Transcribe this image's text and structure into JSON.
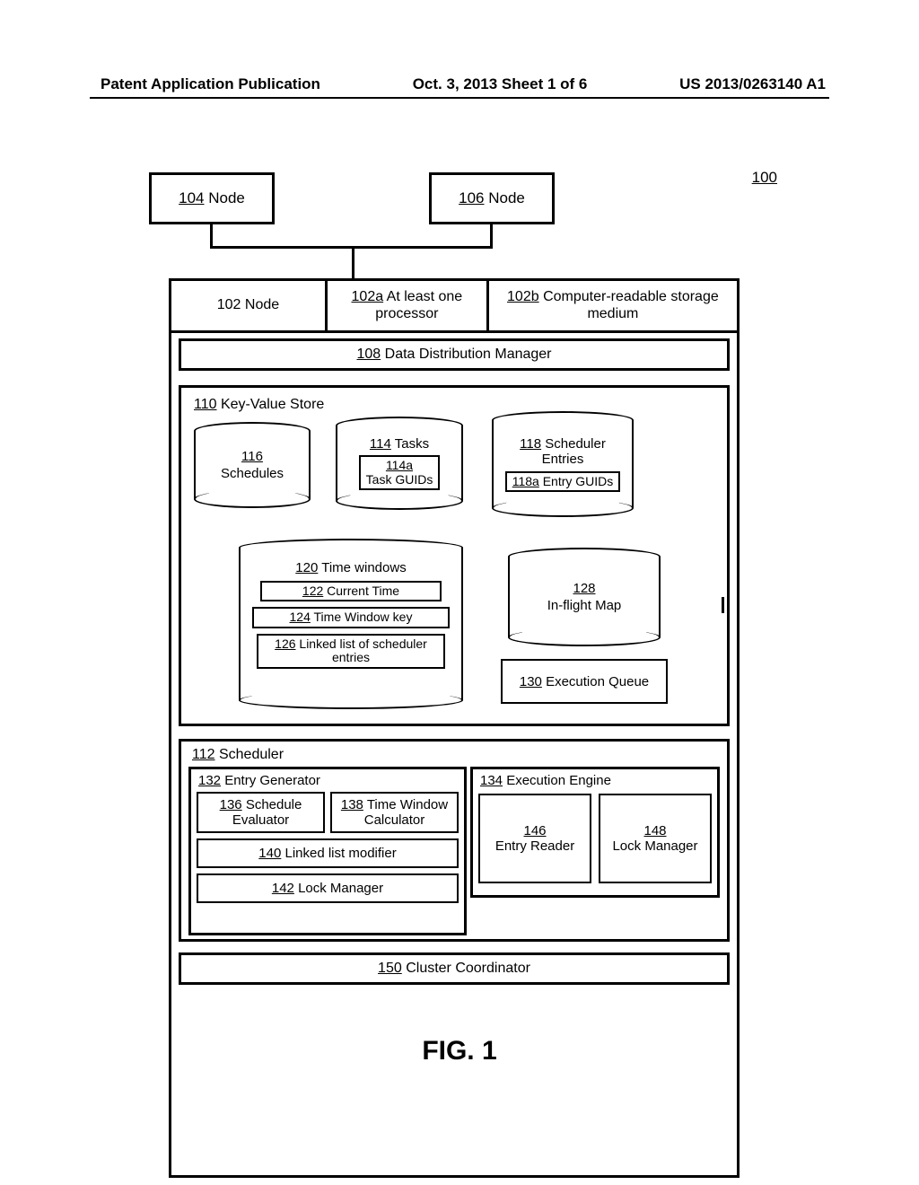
{
  "header": {
    "left": "Patent Application Publication",
    "center": "Oct. 3, 2013   Sheet 1 of 6",
    "right": "US 2013/0263140 A1"
  },
  "system_ref": "100",
  "figure_label": "FIG. 1",
  "nodes": {
    "n104": {
      "ref": "104",
      "label": "Node"
    },
    "n106": {
      "ref": "106",
      "label": "Node"
    },
    "n102": {
      "label": "102 Node"
    },
    "n102a": {
      "ref": "102a",
      "label": "At least one processor"
    },
    "n102b": {
      "ref": "102b",
      "label": "Computer-readable storage medium"
    }
  },
  "ddm": {
    "ref": "108",
    "label": "Data Distribution Manager"
  },
  "kv": {
    "title": {
      "ref": "110",
      "label": "Key-Value Store"
    },
    "c116": {
      "ref": "116",
      "label": "Schedules"
    },
    "c114": {
      "ref": "114",
      "label": "Tasks",
      "inner_ref": "114a",
      "inner_label": "Task GUIDs"
    },
    "c118": {
      "ref": "118",
      "label": "Scheduler Entries",
      "inner_ref": "118a",
      "inner_label": "Entry GUIDs"
    },
    "c120": {
      "ref": "120",
      "label": "Time windows",
      "r122": {
        "ref": "122",
        "label": "Current Time"
      },
      "r124": {
        "ref": "124",
        "label": "Time Window key"
      },
      "r126": {
        "ref": "126",
        "label": "Linked list of scheduler entries"
      }
    },
    "c128": {
      "ref": "128",
      "label": "In-flight Map"
    },
    "c130": {
      "ref": "130",
      "label": "Execution Queue"
    }
  },
  "scheduler": {
    "title": {
      "ref": "112",
      "label": "Scheduler"
    },
    "entry_gen": {
      "ref": "132",
      "label": "Entry Generator",
      "c136": {
        "ref": "136",
        "label": "Schedule Evaluator"
      },
      "c138": {
        "ref": "138",
        "label": "Time Window Calculator"
      },
      "c140": {
        "ref": "140",
        "label": "Linked list modifier"
      },
      "c142": {
        "ref": "142",
        "label": "Lock Manager"
      }
    },
    "exec_engine": {
      "ref": "134",
      "label": "Execution Engine",
      "c146": {
        "ref": "146",
        "label": "Entry Reader"
      },
      "c148": {
        "ref": "148",
        "label": "Lock Manager"
      }
    }
  },
  "cluster_coord": {
    "ref": "150",
    "label": "Cluster Coordinator"
  }
}
